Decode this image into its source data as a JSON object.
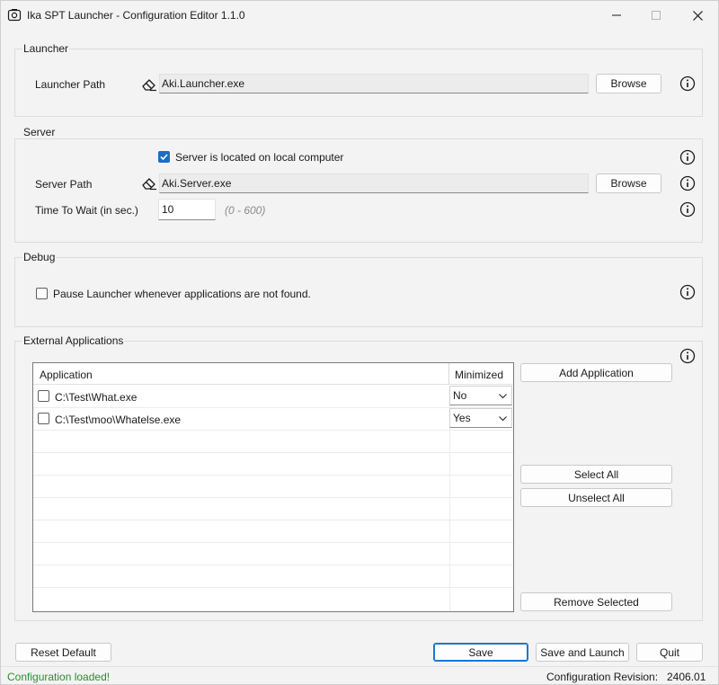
{
  "window": {
    "title": "Ika SPT Launcher - Configuration Editor 1.1.0"
  },
  "launcher": {
    "group_label": "Launcher",
    "path_label": "Launcher Path",
    "path_value": "Aki.Launcher.exe",
    "browse_label": "Browse"
  },
  "server": {
    "group_label": "Server",
    "local_checkbox_label": "Server is located on local computer",
    "local_checked": true,
    "path_label": "Server Path",
    "path_value": "Aki.Server.exe",
    "browse_label": "Browse",
    "wait_label": "Time To Wait (in sec.)",
    "wait_value": "10",
    "wait_hint": "(0 - 600)"
  },
  "debug": {
    "group_label": "Debug",
    "pause_label": "Pause Launcher whenever applications are not found.",
    "pause_checked": false
  },
  "external": {
    "group_label": "External Applications",
    "columns": {
      "application": "Application",
      "minimized": "Minimized"
    },
    "rows": [
      {
        "path": "C:\\Test\\What.exe",
        "minimized": "No",
        "checked": false
      },
      {
        "path": "C:\\Test\\moo\\Whatelse.exe",
        "minimized": "Yes",
        "checked": false
      }
    ],
    "add_label": "Add Application",
    "select_all_label": "Select All",
    "unselect_all_label": "Unselect All",
    "remove_label": "Remove Selected"
  },
  "footer": {
    "reset_label": "Reset Default",
    "save_label": "Save",
    "save_launch_label": "Save and Launch",
    "quit_label": "Quit"
  },
  "status": {
    "message": "Configuration loaded!",
    "revision_label": "Configuration Revision:",
    "revision_value": "2406.01"
  },
  "colors": {
    "status_ok": "#2e8b2e",
    "accent": "#1a6fc4"
  }
}
